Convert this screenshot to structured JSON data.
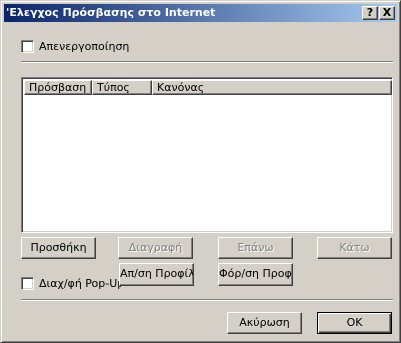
{
  "window": {
    "title": "'Ελεγχος Πρόσβασης στο Internet",
    "help_label": "?",
    "close_label": "X"
  },
  "disable_checkbox": {
    "label": "Απενεργοποίηση",
    "checked": false
  },
  "rules_list": {
    "columns": [
      "Πρόσβαση",
      "Τύπος",
      "Κανόνας"
    ],
    "rows": []
  },
  "action_buttons": {
    "add": "Προσθήκη",
    "delete": "Διαγραφή",
    "up": "Επάνω",
    "down": "Κάτω"
  },
  "popup_checkbox": {
    "label": "Διαχ/φή Pop-Up",
    "checked": false
  },
  "profile_buttons": {
    "save_profile": "Απ/ση Προφίλ",
    "load_profile": "Φόρ/ση Προφίλ"
  },
  "dialog_buttons": {
    "cancel": "Ακύρωση",
    "ok": "OK"
  }
}
